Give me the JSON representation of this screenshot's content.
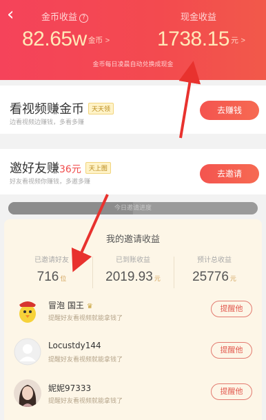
{
  "header": {
    "back_icon": "chevron-left-icon",
    "coin_label": "金币收益",
    "coin_help": "?",
    "coin_value": "82.65w",
    "coin_unit": "金币",
    "coin_chevron": ">",
    "cash_label": "现金收益",
    "cash_value": "1738.15",
    "cash_unit": "元",
    "cash_chevron": ">",
    "note": "金币每日凌晨自动兑换成现金"
  },
  "watch_card": {
    "title": "看视频赚金币",
    "tag": "天天领",
    "subtitle": "边看视频边赚钱，多看多赚",
    "button": "去赚钱"
  },
  "invite_card": {
    "title_prefix": "邀好友赚",
    "title_amount": "36元",
    "tag": "天上图",
    "subtitle": "好友看视频你赚钱，多邀多赚",
    "button": "去邀请"
  },
  "progress_banner": {
    "text": "今日邀请进度",
    "progress": 0.5
  },
  "invite_earnings": {
    "title": "我的邀请收益",
    "stats": [
      {
        "label": "已邀请好友",
        "value": "716",
        "unit": "位"
      },
      {
        "label": "已到账收益",
        "value": "2019.93",
        "unit": "元"
      },
      {
        "label": "预计总收益",
        "value": "25776",
        "unit": "元"
      }
    ],
    "friends": [
      {
        "name": "冒泡 国王",
        "badge": "crown-icon",
        "subtitle": "提醒好友看视频就能拿钱了",
        "button": "提醒他"
      },
      {
        "name": "Locustdy144",
        "subtitle": "提醒好友看视频就能拿钱了",
        "button": "提醒他"
      },
      {
        "name": "妮妮97333",
        "subtitle": "提醒好友看视频就能拿钱了",
        "button": "提醒他"
      }
    ]
  },
  "colors": {
    "header_red": "#f34a4f",
    "gold_text": "#ffe9b8",
    "button_red": "#f4544f",
    "invite_bg": "#fdf6e7",
    "annotation_arrow": "#e8322e"
  }
}
